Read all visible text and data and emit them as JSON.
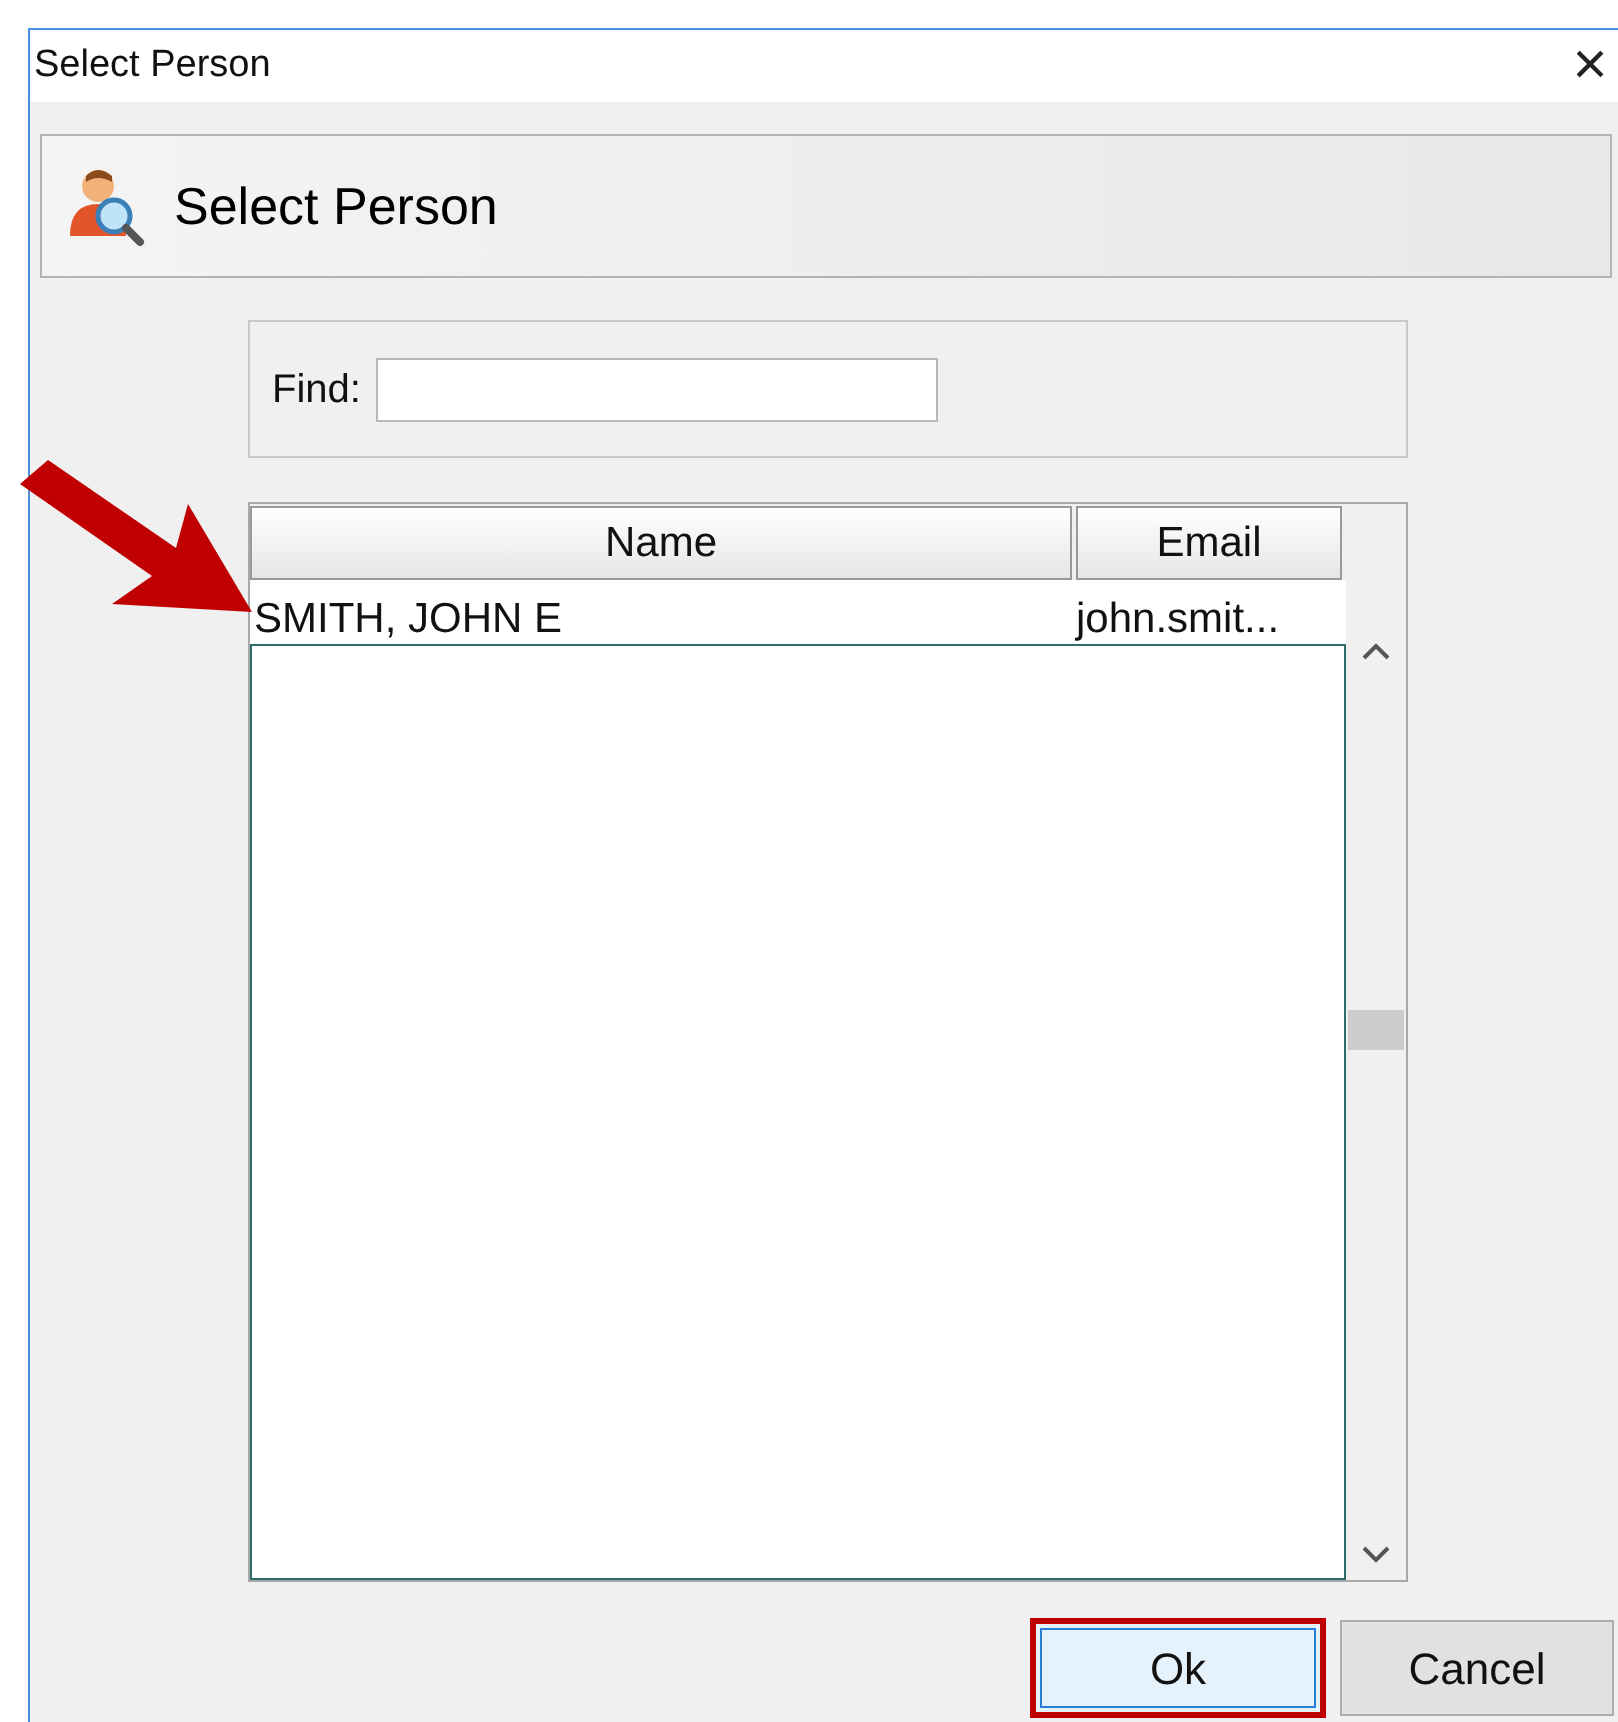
{
  "window": {
    "title": "Select Person",
    "close": "×"
  },
  "header": {
    "title": "Select Person"
  },
  "find": {
    "label": "Find:"
  },
  "table": {
    "columns": [
      "Name",
      "Email"
    ],
    "rows": [
      {
        "name": "SMITH, JOHN E",
        "email": "john.smit..."
      }
    ]
  },
  "buttons": [
    {
      "label": "Ok",
      "highlighted": true
    },
    {
      "label": "Cancel",
      "highlighted": false
    }
  ],
  "annotation": {
    "kind": "arrow"
  }
}
